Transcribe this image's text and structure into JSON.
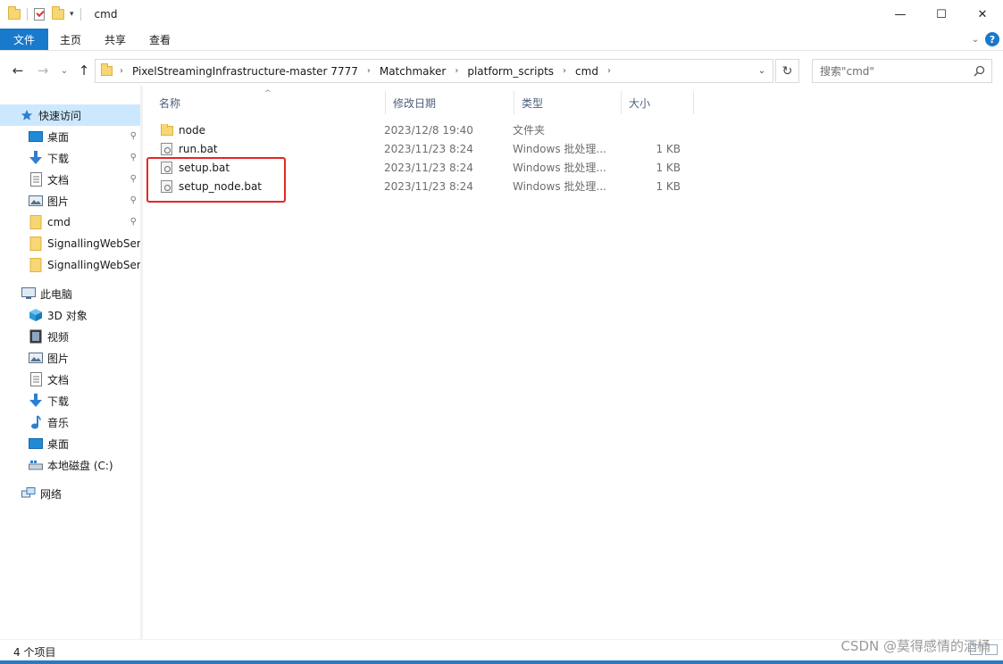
{
  "window": {
    "title": "cmd",
    "minimize_glyph": "—",
    "maximize_glyph": "☐",
    "close_glyph": "✕"
  },
  "ribbon": {
    "tabs": [
      "文件",
      "主页",
      "共享",
      "查看"
    ],
    "collapse_glyph": "⌄",
    "help_glyph": "?"
  },
  "address": {
    "back_glyph": "←",
    "forward_glyph": "→",
    "recent_glyph": "⌄",
    "up_glyph": "↑",
    "crumbs": [
      "PixelStreamingInfrastructure-master 7777",
      "Matchmaker",
      "platform_scripts",
      "cmd"
    ],
    "crumb_sep": "›",
    "dropdown_glyph": "⌄",
    "refresh_glyph": "↻"
  },
  "search": {
    "placeholder": "搜索\"cmd\""
  },
  "sidebar": {
    "quick_access": "快速访问",
    "pinned": [
      {
        "label": "桌面",
        "icon": "desktop-icon"
      },
      {
        "label": "下载",
        "icon": "download-icon"
      },
      {
        "label": "文档",
        "icon": "document-icon"
      },
      {
        "label": "图片",
        "icon": "pictures-icon"
      },
      {
        "label": "cmd",
        "icon": "folder-icon"
      },
      {
        "label": "SignallingWebServer",
        "icon": "folder-icon"
      },
      {
        "label": "SignallingWebServer",
        "icon": "folder-icon"
      }
    ],
    "this_pc": "此电脑",
    "pc_items": [
      {
        "label": "3D 对象",
        "icon": "3d-objects-icon"
      },
      {
        "label": "视频",
        "icon": "video-icon"
      },
      {
        "label": "图片",
        "icon": "pictures-icon"
      },
      {
        "label": "文档",
        "icon": "document-icon"
      },
      {
        "label": "下载",
        "icon": "download-icon"
      },
      {
        "label": "音乐",
        "icon": "music-icon"
      },
      {
        "label": "桌面",
        "icon": "desktop-icon"
      },
      {
        "label": "本地磁盘 (C:)",
        "icon": "drive-icon"
      }
    ],
    "network": "网络",
    "pin_glyph": "📌"
  },
  "columns": {
    "name": "名称",
    "date": "修改日期",
    "type": "类型",
    "size": "大小",
    "sort_glyph": "^"
  },
  "files": [
    {
      "name": "node",
      "date": "2023/12/8 19:40",
      "type": "文件夹",
      "size": "",
      "kind": "folder"
    },
    {
      "name": "run.bat",
      "date": "2023/11/23 8:24",
      "type": "Windows 批处理...",
      "size": "1 KB",
      "kind": "bat"
    },
    {
      "name": "setup.bat",
      "date": "2023/11/23 8:24",
      "type": "Windows 批处理...",
      "size": "1 KB",
      "kind": "bat"
    },
    {
      "name": "setup_node.bat",
      "date": "2023/11/23 8:24",
      "type": "Windows 批处理...",
      "size": "1 KB",
      "kind": "bat"
    }
  ],
  "status": {
    "count": "4 个项目"
  },
  "watermark": "CSDN @莫得感情的酒桶",
  "colors": {
    "accent": "#1979ca",
    "selected": "#cce8ff",
    "highlight_border": "#e52626",
    "folder": "#f7d674"
  }
}
